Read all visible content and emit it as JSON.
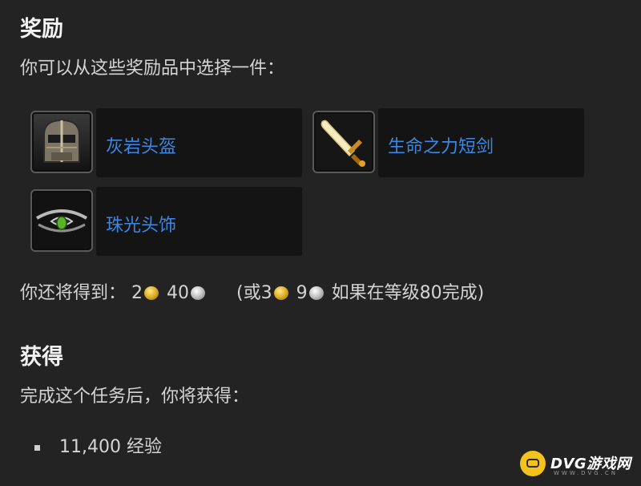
{
  "rewards_section": {
    "heading": "奖励",
    "intro": "你可以从这些奖励品中选择一件：",
    "items": [
      {
        "name": "灰岩头盔",
        "icon": "helmet-icon"
      },
      {
        "name": "生命之力短剑",
        "icon": "dagger-icon"
      },
      {
        "name": "珠光头饰",
        "icon": "circlet-icon"
      }
    ],
    "money": {
      "label": "你还将得到：",
      "gold": "2",
      "silver": "40",
      "alt_prefix": "(或",
      "alt_gold": "3",
      "alt_silver": "9",
      "alt_suffix": "如果在等级80完成)"
    }
  },
  "gains_section": {
    "heading": "获得",
    "intro": "完成这个任务后，你将获得：",
    "list": [
      "11,400 经验"
    ]
  },
  "watermark": {
    "brand": "DVG游戏网",
    "domain": "WWW.DVG.CN"
  },
  "colors": {
    "background": "#232323",
    "link": "#3c87e3",
    "gold_coin": "#d9a81c",
    "silver_coin": "#b8b8b8"
  }
}
